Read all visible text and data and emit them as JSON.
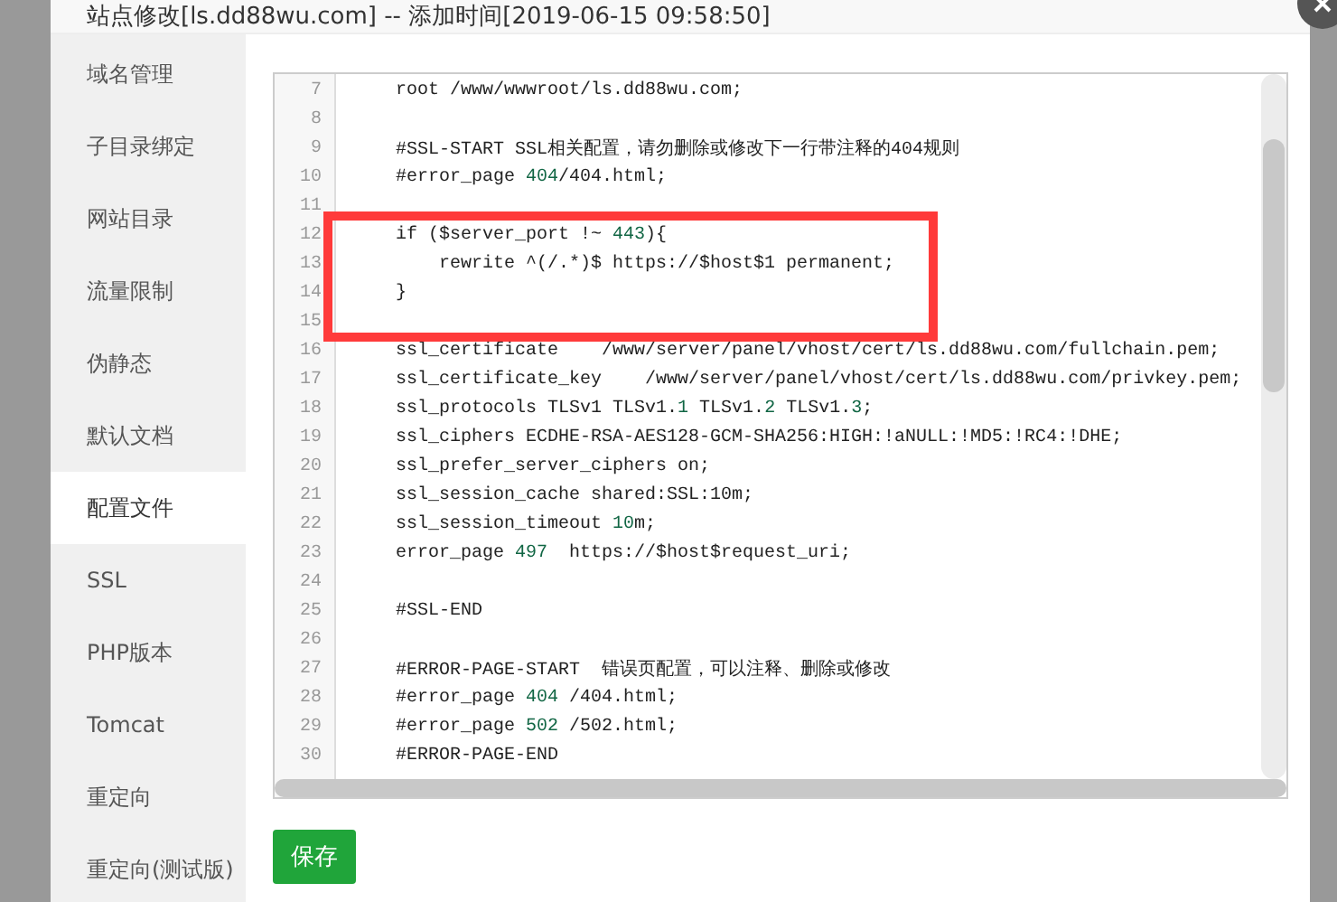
{
  "dialog": {
    "title": "站点修改[ls.dd88wu.com] -- 添加时间[2019-06-15 09:58:50]"
  },
  "sidebar": {
    "items": [
      {
        "label": "域名管理",
        "selected": false
      },
      {
        "label": "子目录绑定",
        "selected": false
      },
      {
        "label": "网站目录",
        "selected": false
      },
      {
        "label": "流量限制",
        "selected": false
      },
      {
        "label": "伪静态",
        "selected": false
      },
      {
        "label": "默认文档",
        "selected": false
      },
      {
        "label": "配置文件",
        "selected": true
      },
      {
        "label": "SSL",
        "selected": false
      },
      {
        "label": "PHP版本",
        "selected": false
      },
      {
        "label": "Tomcat",
        "selected": false
      },
      {
        "label": "重定向",
        "selected": false
      },
      {
        "label": "重定向(测试版)",
        "selected": false
      }
    ]
  },
  "editor": {
    "lines": [
      {
        "number": "7",
        "parts": [
          {
            "kind": "plain",
            "text": "    root /www/wwwroot/ls.dd88wu.com;"
          }
        ]
      },
      {
        "number": "8"
      },
      {
        "number": "9",
        "parts": [
          {
            "kind": "plain",
            "text": "    #SSL-START SSL相关配置，请勿删除或修改下一行带注释的404规则"
          }
        ]
      },
      {
        "number": "10",
        "parts": [
          {
            "kind": "plain",
            "text": "    #error_page "
          },
          {
            "kind": "number",
            "text": "404"
          },
          {
            "kind": "plain",
            "text": "/404.html;"
          }
        ]
      },
      {
        "number": "11"
      },
      {
        "number": "12",
        "parts": [
          {
            "kind": "plain",
            "text": "    if ($server_port !~ "
          },
          {
            "kind": "number",
            "text": "443"
          },
          {
            "kind": "plain",
            "text": "){"
          }
        ]
      },
      {
        "number": "13",
        "parts": [
          {
            "kind": "plain",
            "text": "        rewrite ^(/.*)$ https://$host$1 permanent;"
          }
        ]
      },
      {
        "number": "14",
        "parts": [
          {
            "kind": "plain",
            "text": "    }"
          }
        ]
      },
      {
        "number": "15"
      },
      {
        "number": "16",
        "parts": [
          {
            "kind": "plain",
            "text": "    ssl_certificate    /www/server/panel/vhost/cert/ls.dd88wu.com/fullchain.pem;"
          }
        ]
      },
      {
        "number": "17",
        "parts": [
          {
            "kind": "plain",
            "text": "    ssl_certificate_key    /www/server/panel/vhost/cert/ls.dd88wu.com/privkey.pem;"
          }
        ]
      },
      {
        "number": "18",
        "parts": [
          {
            "kind": "plain",
            "text": "    ssl_protocols TLSv1 TLSv1."
          },
          {
            "kind": "number",
            "text": "1"
          },
          {
            "kind": "plain",
            "text": " TLSv1."
          },
          {
            "kind": "number",
            "text": "2"
          },
          {
            "kind": "plain",
            "text": " TLSv1."
          },
          {
            "kind": "number",
            "text": "3"
          },
          {
            "kind": "plain",
            "text": ";"
          }
        ]
      },
      {
        "number": "19",
        "parts": [
          {
            "kind": "plain",
            "text": "    ssl_ciphers ECDHE-RSA-AES128-GCM-SHA256:HIGH:!aNULL:!MD5:!RC4:!DHE;"
          }
        ]
      },
      {
        "number": "20",
        "parts": [
          {
            "kind": "plain",
            "text": "    ssl_prefer_server_ciphers on;"
          }
        ]
      },
      {
        "number": "21",
        "parts": [
          {
            "kind": "plain",
            "text": "    ssl_session_cache shared:SSL:10m;"
          }
        ]
      },
      {
        "number": "22",
        "parts": [
          {
            "kind": "plain",
            "text": "    ssl_session_timeout "
          },
          {
            "kind": "number",
            "text": "10"
          },
          {
            "kind": "plain",
            "text": "m;"
          }
        ]
      },
      {
        "number": "23",
        "parts": [
          {
            "kind": "plain",
            "text": "    error_page "
          },
          {
            "kind": "number",
            "text": "497"
          },
          {
            "kind": "plain",
            "text": "  https://$host$request_uri;"
          }
        ]
      },
      {
        "number": "24"
      },
      {
        "number": "25",
        "parts": [
          {
            "kind": "plain",
            "text": "    #SSL-END"
          }
        ]
      },
      {
        "number": "26"
      },
      {
        "number": "27",
        "parts": [
          {
            "kind": "plain",
            "text": "    #ERROR-PAGE-START  错误页配置，可以注释、删除或修改"
          }
        ]
      },
      {
        "number": "28",
        "parts": [
          {
            "kind": "plain",
            "text": "    #error_page "
          },
          {
            "kind": "number",
            "text": "404"
          },
          {
            "kind": "plain",
            "text": " /404.html;"
          }
        ]
      },
      {
        "number": "29",
        "parts": [
          {
            "kind": "plain",
            "text": "    #error_page "
          },
          {
            "kind": "number",
            "text": "502"
          },
          {
            "kind": "plain",
            "text": " /502.html;"
          }
        ]
      },
      {
        "number": "30",
        "parts": [
          {
            "kind": "plain",
            "text": "    #ERROR-PAGE-END"
          }
        ]
      }
    ]
  },
  "buttons": [
    {
      "label": "保存"
    }
  ]
}
